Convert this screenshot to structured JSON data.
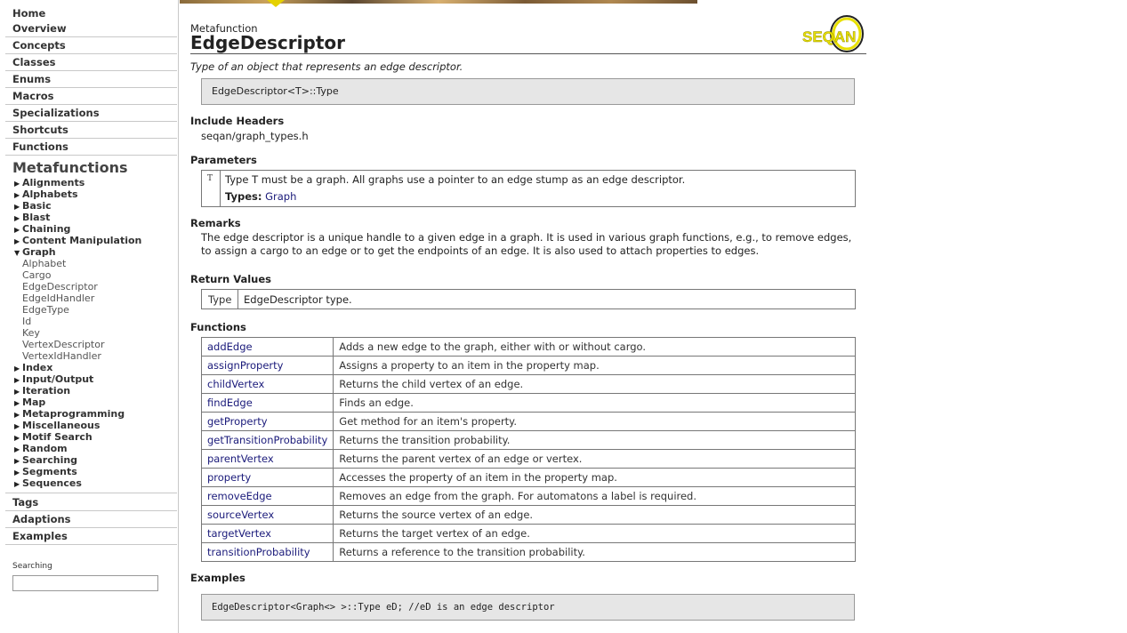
{
  "sidebar": {
    "top_links": [
      "Home",
      "Overview",
      "Concepts",
      "Classes",
      "Enums",
      "Macros",
      "Specializations",
      "Shortcuts",
      "Functions"
    ],
    "section_heading": "Metafunctions",
    "categories": [
      "Alignments",
      "Alphabets",
      "Basic",
      "Blast",
      "Chaining",
      "Content Manipulation",
      "Graph",
      "Index",
      "Input/Output",
      "Iteration",
      "Map",
      "Metaprogramming",
      "Miscellaneous",
      "Motif Search",
      "Random",
      "Searching",
      "Segments",
      "Sequences"
    ],
    "expanded_category": "Graph",
    "graph_items": [
      "Alphabet",
      "Cargo",
      "EdgeDescriptor",
      "EdgeIdHandler",
      "EdgeType",
      "Id",
      "Key",
      "VertexDescriptor",
      "VertexIdHandler"
    ],
    "bottom_links": [
      "Tags",
      "Adaptions",
      "Examples"
    ],
    "search_label": "Searching",
    "search_value": ""
  },
  "logo": {
    "text": "SEQAN",
    "color": "#e8e000"
  },
  "page": {
    "kicker": "Metafunction",
    "title": "EdgeDescriptor",
    "summary": "Type of an object that represents an edge descriptor.",
    "signature": "EdgeDescriptor<T>::Type",
    "include_heading": "Include Headers",
    "include_file": "seqan/graph_types.h",
    "params_heading": "Parameters",
    "param_name": "T",
    "param_desc": "Type T must be a graph. All graphs use a pointer to an edge stump as an edge descriptor.",
    "param_types_label": "Types:",
    "param_types_link": "Graph",
    "remarks_heading": "Remarks",
    "remarks": "The edge descriptor is a unique handle to a given edge in a graph. It is used in various graph functions, e.g., to remove edges, to assign a cargo to an edge or to get the endpoints of an edge. It is also used to attach properties to edges.",
    "returns_heading": "Return Values",
    "return_type": "Type",
    "return_desc": "EdgeDescriptor type.",
    "functions_heading": "Functions",
    "functions": [
      {
        "name": "addEdge",
        "desc": "Adds a new edge to the graph, either with or without cargo."
      },
      {
        "name": "assignProperty",
        "desc": "Assigns a property to an item in the property map."
      },
      {
        "name": "childVertex",
        "desc": "Returns the child vertex of an edge."
      },
      {
        "name": "findEdge",
        "desc": "Finds an edge."
      },
      {
        "name": "getProperty",
        "desc": "Get method for an item's property."
      },
      {
        "name": "getTransitionProbability",
        "desc": "Returns the transition probability."
      },
      {
        "name": "parentVertex",
        "desc": "Returns the parent vertex of an edge or vertex."
      },
      {
        "name": "property",
        "desc": "Accesses the property of an item in the property map."
      },
      {
        "name": "removeEdge",
        "desc": "Removes an edge from the graph. For automatons a label is required."
      },
      {
        "name": "sourceVertex",
        "desc": "Returns the source vertex of an edge."
      },
      {
        "name": "targetVertex",
        "desc": "Returns the target vertex of an edge."
      },
      {
        "name": "transitionProbability",
        "desc": "Returns a reference to the transition probability."
      }
    ],
    "examples_heading": "Examples",
    "example_code": "EdgeDescriptor<Graph<> >::Type eD; //eD is an edge descriptor"
  }
}
